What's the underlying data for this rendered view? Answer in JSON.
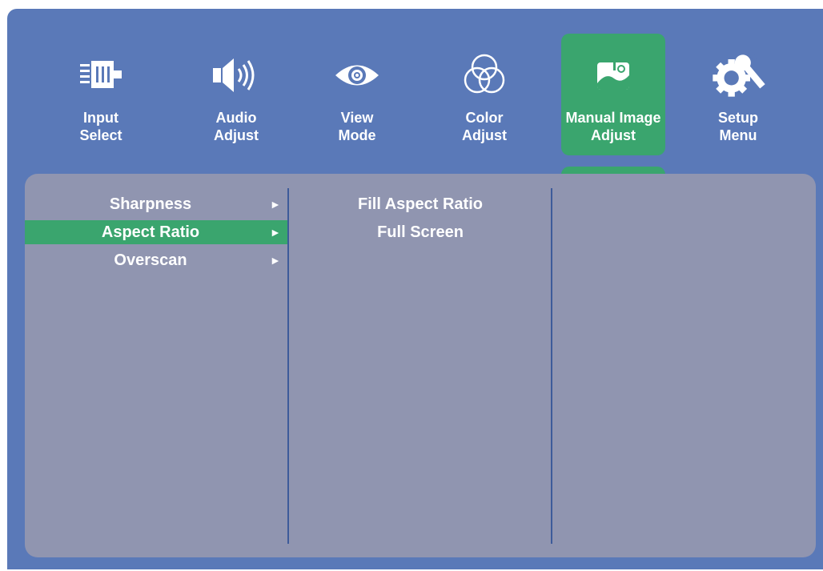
{
  "colors": {
    "osd_background": "#5a79b8",
    "panel_background": "#9095b0",
    "accent_green": "#3aa56e",
    "divider": "#3d5b9a",
    "text": "#ffffff"
  },
  "tabs": [
    {
      "line1": "Input",
      "line2": "Select",
      "icon": "input-select-icon",
      "active": false
    },
    {
      "line1": "Audio",
      "line2": "Adjust",
      "icon": "speaker-icon",
      "active": false
    },
    {
      "line1": "View",
      "line2": "Mode",
      "icon": "eye-icon",
      "active": false
    },
    {
      "line1": "Color",
      "line2": "Adjust",
      "icon": "color-circles-icon",
      "active": false
    },
    {
      "line1": "Manual Image",
      "line2": "Adjust",
      "icon": "image-adjust-icon",
      "active": true
    },
    {
      "line1": "Setup",
      "line2": "Menu",
      "icon": "gear-wrench-icon",
      "active": false
    }
  ],
  "menu": {
    "items": [
      {
        "label": "Sharpness",
        "arrow": "►",
        "selected": false
      },
      {
        "label": "Aspect Ratio",
        "arrow": "►",
        "selected": true
      },
      {
        "label": "Overscan",
        "arrow": "►",
        "selected": false
      }
    ]
  },
  "submenu": {
    "options": [
      {
        "label": "Fill Aspect Ratio"
      },
      {
        "label": "Full Screen"
      }
    ]
  }
}
